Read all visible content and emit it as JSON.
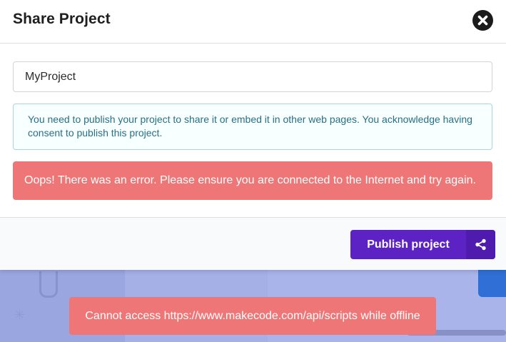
{
  "modal": {
    "title": "Share Project",
    "close_icon": "close-icon",
    "project_name": {
      "value": "MyProject",
      "placeholder": ""
    },
    "info_message": "You need to publish your project to share it or embed it in other web pages. You acknowledge having consent to publish this project.",
    "error_message": "Oops! There was an error. Please ensure you are connected to the Internet and try again.",
    "footer": {
      "publish_label": "Publish project",
      "publish_icon": "share-icon"
    }
  },
  "toast": {
    "message": "Cannot access https://www.makecode.com/api/scripts while offline"
  },
  "colors": {
    "publish_button": "#5c22c4",
    "publish_icon_bg": "#4f1aae",
    "error_bg": "#ee7676",
    "info_bg": "#f8ffff",
    "info_border": "#a9d5de",
    "info_text": "#276f86",
    "backdrop": "#a3aee5"
  }
}
